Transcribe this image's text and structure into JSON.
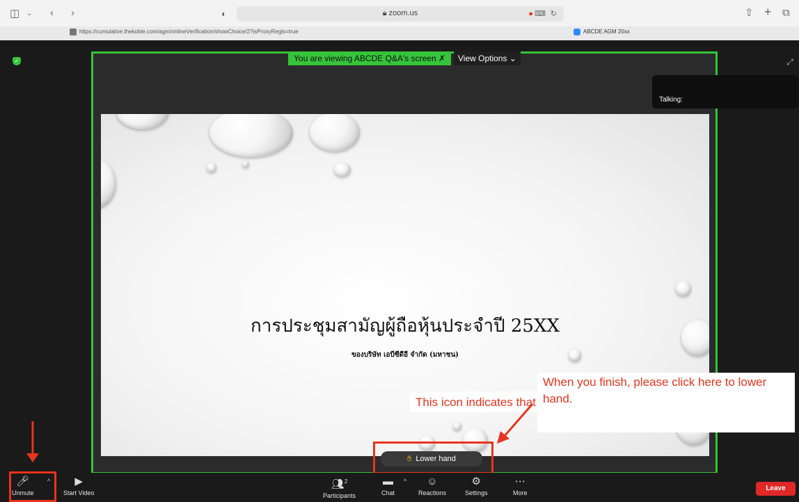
{
  "browser": {
    "address_domain": "zoom.us",
    "tab1_url": "https://cumulative.thekoble.com/agm/onlineVerification/showChoice/2?isProxyRegis=true",
    "tab2_title": "ABCDE AGM 20xx"
  },
  "zoom": {
    "viewing_banner": "You are viewing ABCDE Q&A's screen",
    "view_options_label": "View Options",
    "talking_label": "Talking:",
    "slide": {
      "title": "การประชุมสามัญผู้ถือหุ้นประจำปี 25XX",
      "subtitle": "ของบริษัท เอบีซีดีอี จำกัด (มหาชน)"
    },
    "lower_hand_label": "Lower hand",
    "toolbar": {
      "unmute": "Unmute",
      "start_video": "Start Video",
      "participants": "Participants",
      "participants_count": "2",
      "chat": "Chat",
      "reactions": "Reactions",
      "settings": "Settings",
      "more": "More",
      "leave": "Leave"
    }
  },
  "annotations": {
    "mic_note": "This icon indicates that your microphone is muted",
    "hand_note": "When you finish, please click here to lower hand.",
    "accent_color": "#e8341c"
  }
}
